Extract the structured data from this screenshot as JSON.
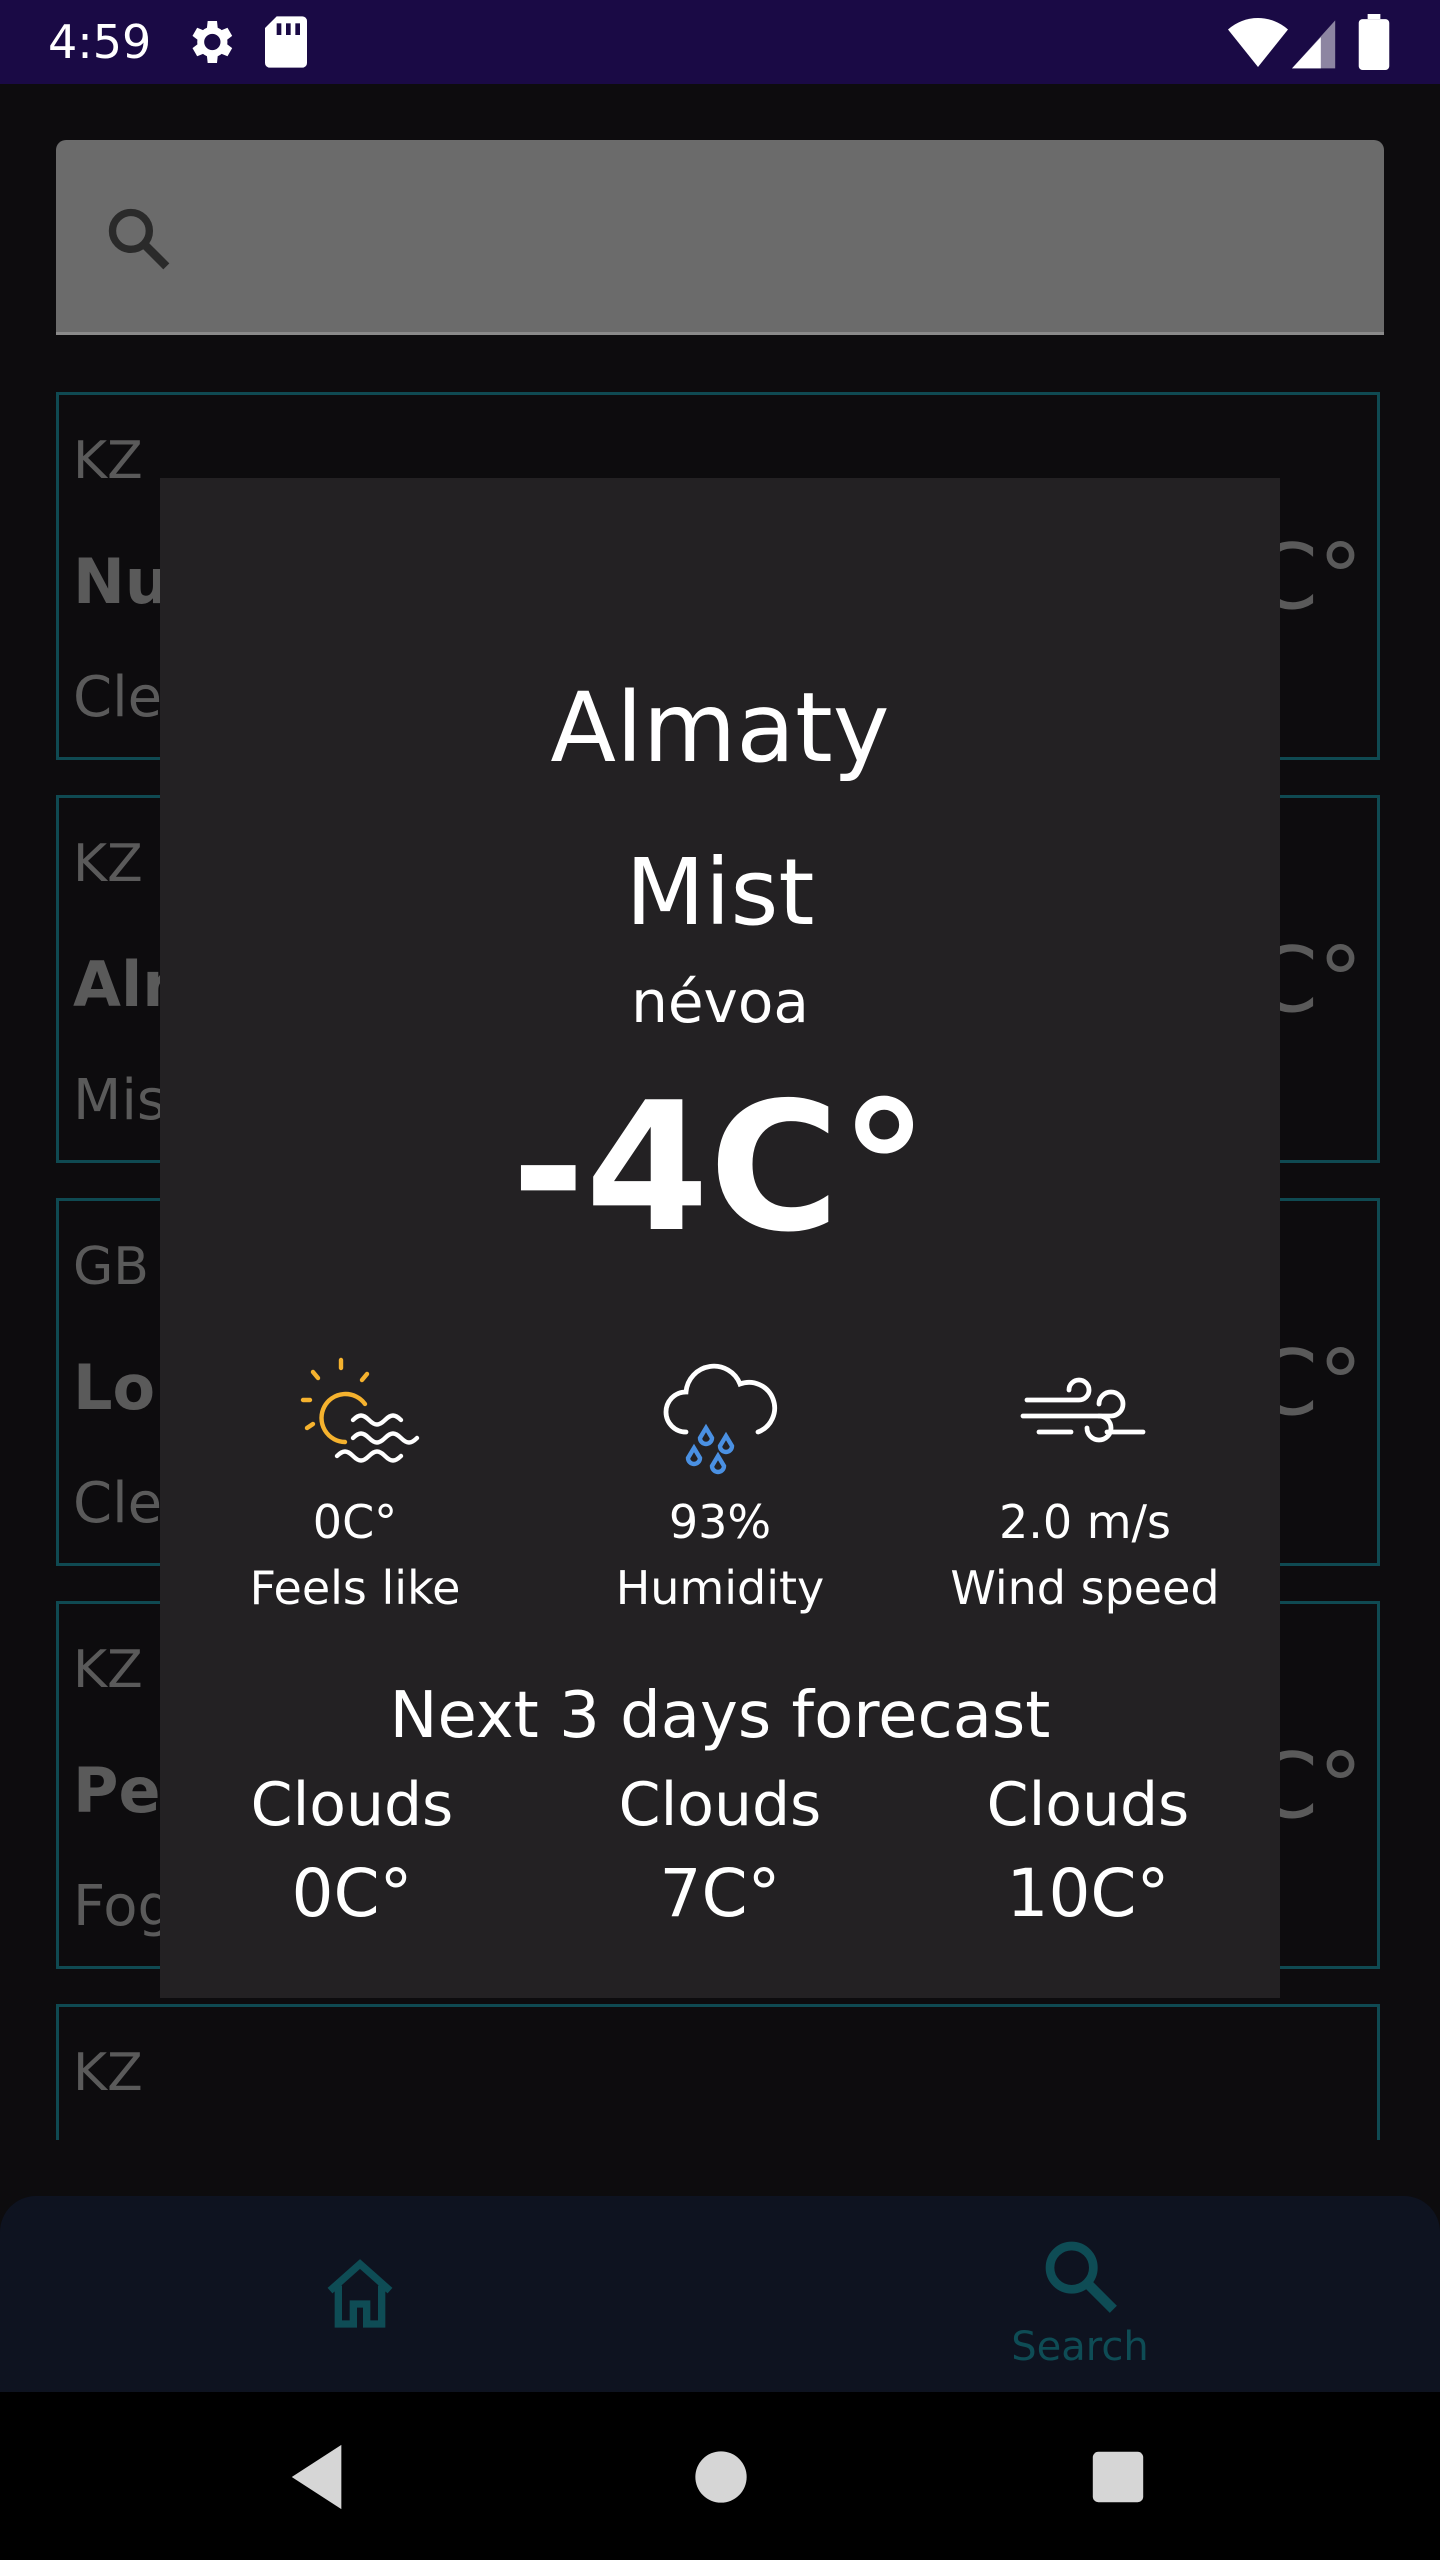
{
  "status_bar": {
    "time": "4:59"
  },
  "search": {
    "placeholder": ""
  },
  "cards": [
    {
      "country": "KZ",
      "city": "Nu",
      "desc": "Cle",
      "temp": "C°"
    },
    {
      "country": "KZ",
      "city": "Alr",
      "desc": "Mis",
      "temp": "C°"
    },
    {
      "country": "GB",
      "city": "Lor",
      "desc": "Cle",
      "temp": "C°"
    },
    {
      "country": "KZ",
      "city": "Per",
      "desc": "Fog",
      "temp": "C°"
    },
    {
      "country": "KZ",
      "city": "",
      "desc": "",
      "temp": ""
    }
  ],
  "dialog": {
    "city": "Almaty",
    "main": "Mist",
    "description": "névoa",
    "temp": "-4C°",
    "stats": [
      {
        "icon": "fog-sun-icon",
        "value": "0C°",
        "label": "Feels like"
      },
      {
        "icon": "rain-cloud-icon",
        "value": "93%",
        "label": "Humidity"
      },
      {
        "icon": "wind-icon",
        "value": "2.0 m/s",
        "label": "Wind speed"
      }
    ],
    "forecast_title": "Next 3 days forecast",
    "forecast": [
      {
        "main": "Clouds",
        "temp": "0C°"
      },
      {
        "main": "Clouds",
        "temp": "7C°"
      },
      {
        "main": "Clouds",
        "temp": "10C°"
      }
    ]
  },
  "nav": {
    "search_label": "Search"
  },
  "colors": {
    "status_bar": "#1a0a45",
    "dialog_bg": "#232123",
    "accent": "#0e4c55",
    "card_border": "#0f4a52"
  }
}
